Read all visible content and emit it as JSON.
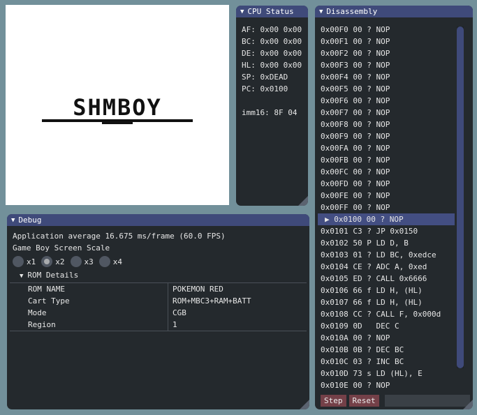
{
  "screen": {
    "logo": "SHMBOY"
  },
  "cpu": {
    "title": "CPU Status",
    "registers": [
      "AF: 0x00 0x00",
      "BC: 0x00 0x00",
      "DE: 0x00 0x00",
      "HL: 0x00 0x00",
      "SP: 0xDEAD",
      "PC: 0x0100"
    ],
    "imm16": "imm16: 8F 04"
  },
  "disasm": {
    "title": "Disassembly",
    "lines_before": [
      "0x00F0 00 ? NOP",
      "0x00F1 00 ? NOP",
      "0x00F2 00 ? NOP",
      "0x00F3 00 ? NOP",
      "0x00F4 00 ? NOP",
      "0x00F5 00 ? NOP",
      "0x00F6 00 ? NOP",
      "0x00F7 00 ? NOP",
      "0x00F8 00 ? NOP",
      "0x00F9 00 ? NOP",
      "0x00FA 00 ? NOP",
      "0x00FB 00 ? NOP",
      "0x00FC 00 ? NOP",
      "0x00FD 00 ? NOP",
      "0x00FE 00 ? NOP",
      "0x00FF 00 ? NOP"
    ],
    "current": "0x0100 00 ? NOP",
    "lines_after": [
      "0x0101 C3 ? JP 0x0150",
      "0x0102 50 P LD D, B",
      "0x0103 01 ? LD BC, 0xedce",
      "0x0104 CE ? ADC A, 0xed",
      "0x0105 ED ? CALL 0x6666",
      "0x0106 66 f LD H, (HL)",
      "0x0107 66 f LD H, (HL)",
      "0x0108 CC ? CALL F, 0x000d",
      "0x0109 0D   DEC C",
      "0x010A 00 ? NOP",
      "0x010B 0B ? DEC BC",
      "0x010C 03 ? INC BC",
      "0x010D 73 s LD (HL), E",
      "0x010E 00 ? NOP"
    ],
    "step_label": "Step",
    "reset_label": "Reset"
  },
  "debug": {
    "title": "Debug",
    "fps_text": "Application average 16.675 ms/frame (60.0 FPS)",
    "scale_label": "Game Boy Screen Scale",
    "scales": [
      {
        "label": "x1",
        "selected": false
      },
      {
        "label": "x2",
        "selected": true
      },
      {
        "label": "x3",
        "selected": false
      },
      {
        "label": "x4",
        "selected": false
      }
    ],
    "rom_details_label": "ROM Details",
    "rom_rows": [
      {
        "key": "ROM NAME",
        "value": "POKEMON RED"
      },
      {
        "key": "Cart Type",
        "value": "ROM+MBC3+RAM+BATT"
      },
      {
        "key": "Mode",
        "value": "CGB"
      },
      {
        "key": "Region",
        "value": "1"
      }
    ]
  },
  "colors": {
    "background": "#72909a",
    "window_bg": "#24292d",
    "title_bar": "#3f4a7a",
    "button": "#744048",
    "highlight": "#434e82"
  }
}
